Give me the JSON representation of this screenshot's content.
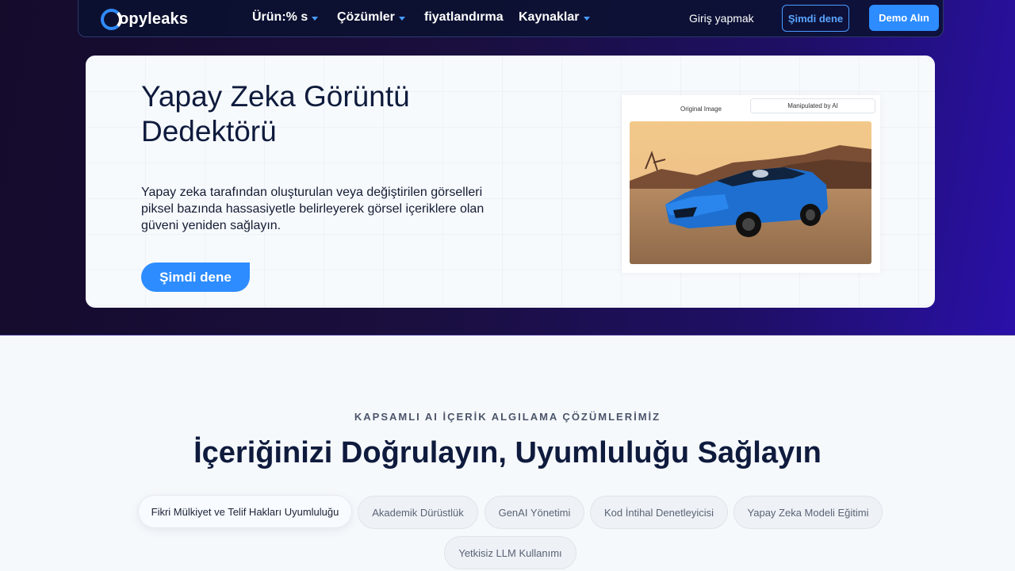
{
  "nav": {
    "logo_text": "opyleaks",
    "items": [
      "Ürün:% s",
      "Çözümler",
      "fiyatlandırma",
      "Kaynaklar"
    ],
    "login": "Giriş yapmak",
    "try_label": "Şimdi dene",
    "demo_label": "Demo Alın"
  },
  "hero": {
    "title": "Yapay Zeka Görüntü Dedektörü",
    "description": "Yapay zeka tarafından oluşturulan veya değiştirilen görselleri piksel bazında hassasiyetle belirleyerek görsel içeriklere olan güveni yeniden sağlayın.",
    "cta": "Şimdi dene",
    "preview": {
      "tab_original": "Original Image",
      "tab_manipulated": "Manipulated by AI"
    }
  },
  "section": {
    "eyebrow": "KAPSAMLI AI İÇERİK ALGILAMA ÇÖZÜMLERİMİZ",
    "headline_regular": "İçeriğinizi Doğrulayın, ",
    "headline_bold": "Uyumluluğu Sağlayın",
    "pills": [
      "Fikri Mülkiyet ve Telif Hakları Uyumluluğu",
      "Akademik Dürüstlük",
      "GenAI Yönetimi",
      "Kod İntihal Denetleyicisi",
      "Yapay Zeka Modeli Eğitimi",
      "Yetkisiz LLM Kullanımı"
    ]
  },
  "colors": {
    "accent": "#2d8cff",
    "hero_bg": "#1a0f3f",
    "text_dark": "#0f1b3d"
  }
}
